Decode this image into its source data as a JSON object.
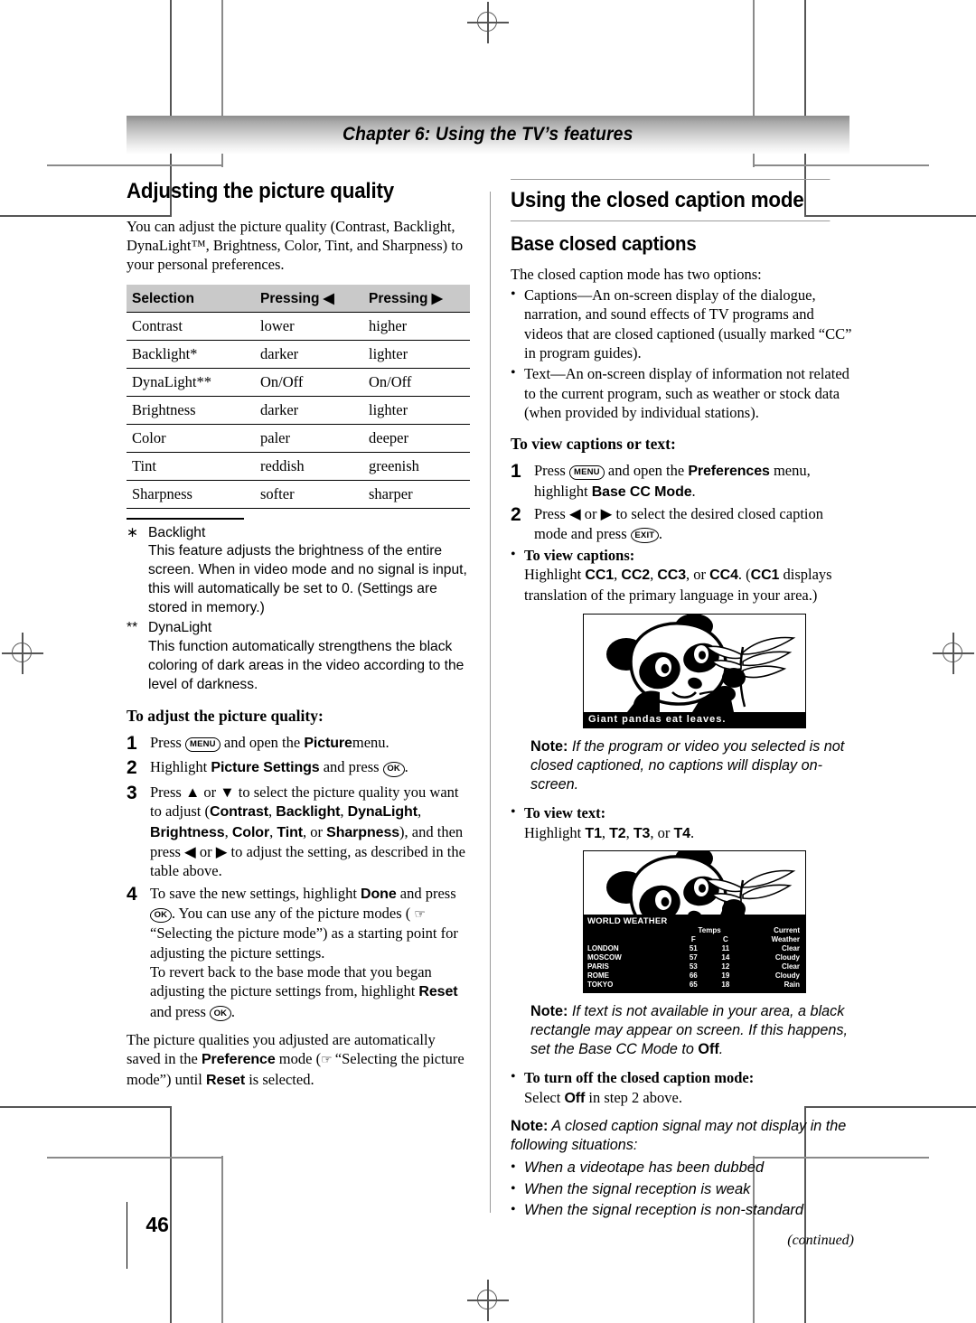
{
  "chapter": {
    "title": "Chapter 6: Using the TV’s features"
  },
  "page_number": "46",
  "continued_label": "(continued)",
  "left": {
    "heading": "Adjusting the picture quality",
    "intro": "You can adjust the picture quality (Contrast, Backlight, DynaLight™, Brightness, Color, Tint, and Sharpness) to your personal preferences.",
    "table": {
      "headers": [
        "Selection",
        "Pressing ◀",
        "Pressing ▶"
      ],
      "rows": [
        [
          "Contrast",
          "lower",
          "higher"
        ],
        [
          "Backlight*",
          "darker",
          "lighter"
        ],
        [
          "DynaLight**",
          "On/Off",
          "On/Off"
        ],
        [
          "Brightness",
          "darker",
          "lighter"
        ],
        [
          "Color",
          "paler",
          "deeper"
        ],
        [
          "Tint",
          "reddish",
          "greenish"
        ],
        [
          "Sharpness",
          "softer",
          "sharper"
        ]
      ]
    },
    "footnotes": [
      {
        "marker": "∗",
        "term": "Backlight",
        "body": "This feature adjusts the brightness of the entire screen. When in video mode and no signal is input, this will automatically be set to 0. (Settings are stored in memory.)"
      },
      {
        "marker": "**",
        "term": "DynaLight",
        "body": "This function automatically strengthens the black coloring of dark areas in the video according to the level of darkness."
      }
    ],
    "procedure_title": "To adjust the picture quality:",
    "step1_a": "Press",
    "step1_key": "MENU",
    "step1_b": "and open the",
    "step1_bold": "Picture",
    "step1_c": "menu.",
    "step2_a": "Highlight",
    "step2_bold": "Picture Settings",
    "step2_b": "and press",
    "step2_key": "OK",
    "step2_c": ".",
    "step3_a": "Press ▲ or ▼ to select the picture quality you want to adjust (",
    "step3_b1": "Contrast",
    "step3_b2": "Backlight",
    "step3_b3": "DynaLight",
    "step3_b4": "Brightness",
    "step3_b5": "Color",
    "step3_b6": "Tint",
    "step3_b7": "Sharpness",
    "step3_mid": "), and then press ◀ or ▶ to adjust the setting, as described in the table above.",
    "step4_a": "To save the new settings, highlight",
    "step4_bold1": "Done",
    "step4_b": "and press",
    "step4_key1": "OK",
    "step4_c": ". You can use any of the picture modes (",
    "step4_d": "“Selecting the picture mode”) as a starting point for adjusting the picture settings.",
    "step4_e": "To revert back to the base mode that you began adjusting the picture settings from, highlight",
    "step4_bold2": "Reset",
    "step4_f": "and press",
    "step4_key2": "OK",
    "step4_g": ".",
    "closing_a": "The picture qualities you adjusted are automatically saved in the",
    "closing_bold1": "Preference",
    "closing_b": "mode (",
    "closing_c": "“Selecting the picture mode”) until",
    "closing_bold2": "Reset",
    "closing_d": "is selected."
  },
  "right": {
    "heading": "Using the closed caption mode",
    "subheading": "Base closed captions",
    "intro": "The closed caption mode has two options:",
    "bullets": [
      "Captions—An on-screen display of the dialogue, narration, and sound effects of TV programs and videos that are closed captioned (usually marked “CC” in program guides).",
      "Text—An on-screen display of information not related to the current program, such as weather or stock data (when provided by individual stations)."
    ],
    "procedure_title": "To view captions or text:",
    "step1_a": "Press",
    "step1_key": "MENU",
    "step1_b": "and open the",
    "step1_bold1": "Preferences",
    "step1_c": "menu, highlight",
    "step1_bold2": "Base CC Mode",
    "step1_d": ".",
    "step2_a": "Press ◀ or ▶ to select the desired closed caption mode and press",
    "step2_key": "EXIT",
    "step2_b": ".",
    "view_captions_title": "To view captions:",
    "view_captions_a": "Highlight",
    "view_captions_cc1": "CC1",
    "view_captions_cc2": "CC2",
    "view_captions_cc3": "CC3",
    "view_captions_cc4": "CC4",
    "view_captions_b": ". (",
    "view_captions_cc1b": "CC1",
    "view_captions_c": "displays translation of the primary language in your area.)",
    "caption_image_text": "Giant  pandas  eat  leaves.",
    "note1_label": "Note:",
    "note1_body": "If the program or video you selected is not closed captioned, no captions will display on-screen.",
    "view_text_title": "To view text:",
    "view_text_a": "Highlight",
    "view_text_t1": "T1",
    "view_text_t2": "T2",
    "view_text_t3": "T3",
    "view_text_t4": "T4",
    "view_text_b": ".",
    "weather": {
      "title": "WORLD WEATHER",
      "col_temps": "Temps",
      "col_f": "F",
      "col_c": "C",
      "col_current": "Current",
      "col_weather": "Weather",
      "rows": [
        [
          "LONDON",
          "51",
          "11",
          "Clear"
        ],
        [
          "MOSCOW",
          "57",
          "14",
          "Cloudy"
        ],
        [
          "PARIS",
          "53",
          "12",
          "Clear"
        ],
        [
          "ROME",
          "66",
          "19",
          "Cloudy"
        ],
        [
          "TOKYO",
          "65",
          "18",
          "Rain"
        ]
      ]
    },
    "note2_label": "Note:",
    "note2_a": "If text is not available in your area, a black rectangle may appear on screen. If this happens, set the Base CC Mode to",
    "note2_bold": "Off",
    "note2_b": ".",
    "turn_off_title": "To turn off the closed caption mode:",
    "turn_off_a": "Select",
    "turn_off_bold": "Off",
    "turn_off_b": "in step 2 above.",
    "note3_label": "Note:",
    "note3_body": "A closed caption signal may not display in the following situations:",
    "note3_bullets": [
      "When a videotape has been dubbed",
      "When the signal reception is weak",
      "When the signal reception is non-standard"
    ]
  }
}
